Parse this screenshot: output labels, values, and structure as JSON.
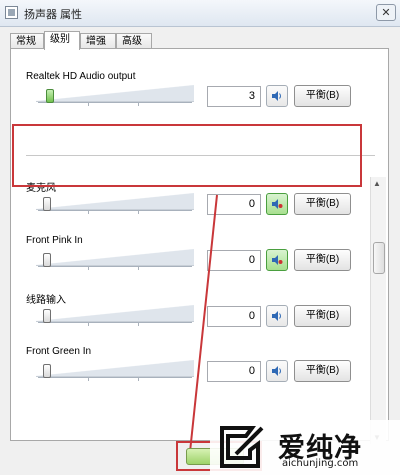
{
  "window": {
    "title": "扬声器 属性",
    "close_symbol": "✕"
  },
  "tabs": [
    {
      "label": "常规",
      "active": false
    },
    {
      "label": "级别",
      "active": true
    },
    {
      "label": "增强",
      "active": false
    },
    {
      "label": "高级",
      "active": false
    }
  ],
  "devices": [
    {
      "label": "Realtek HD Audio output",
      "value": "3",
      "level": 0.03,
      "mute_icon": "speaker-icon",
      "balance": "平衡(B)",
      "highlighted": false
    },
    {
      "label": "麦克风",
      "value": "0",
      "level": 0.0,
      "mute_icon": "microphone-icon",
      "mute_selected": true,
      "balance": "平衡(B)",
      "highlighted": true
    },
    {
      "label": "Front Pink In",
      "value": "0",
      "level": 0.0,
      "mute_icon": "microphone-icon",
      "mute_selected": true,
      "balance": "平衡(B)",
      "highlighted": false
    },
    {
      "label": "线路输入",
      "value": "0",
      "level": 0.0,
      "mute_icon": "speaker-icon",
      "balance": "平衡(B)",
      "highlighted": false
    },
    {
      "label": "Front Green In",
      "value": "0",
      "level": 0.0,
      "mute_icon": "speaker-icon",
      "balance": "平衡(B)",
      "highlighted": false
    }
  ],
  "colors": {
    "annotation": "#c9373a",
    "selected_button": "#a8e08f"
  },
  "watermark": {
    "text": "爱纯净",
    "url": "aichunjing.com"
  }
}
